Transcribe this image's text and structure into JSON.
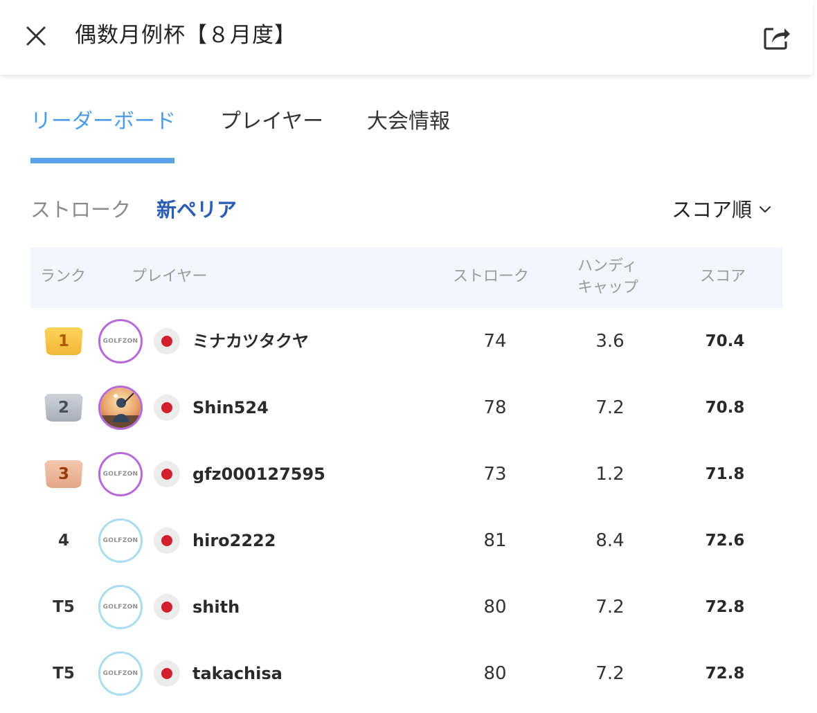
{
  "header": {
    "title": "偶数月例杯【８月度】"
  },
  "tabs": [
    {
      "label": "リーダーボード"
    },
    {
      "label": "プレイヤー"
    },
    {
      "label": "大会情報"
    }
  ],
  "subtabs": {
    "stroke": "ストローク",
    "new_peria": "新ペリア"
  },
  "sort": {
    "label": "スコア順"
  },
  "table": {
    "headers": {
      "rank": "ランク",
      "player": "プレイヤー",
      "stroke": "ストローク",
      "handicap_line1": "ハンディ",
      "handicap_line2": "キャップ",
      "score": "スコア"
    },
    "avatar_logo_text": "GOLFZON",
    "rows": [
      {
        "rank": "1",
        "name": "ミナカツタクヤ",
        "stroke": "74",
        "handicap": "3.6",
        "score": "70.4"
      },
      {
        "rank": "2",
        "name": "Shin524",
        "stroke": "78",
        "handicap": "7.2",
        "score": "70.8"
      },
      {
        "rank": "3",
        "name": "gfz000127595",
        "stroke": "73",
        "handicap": "1.2",
        "score": "71.8"
      },
      {
        "rank": "4",
        "name": "hiro2222",
        "stroke": "81",
        "handicap": "8.4",
        "score": "72.6"
      },
      {
        "rank": "T5",
        "name": "shith",
        "stroke": "80",
        "handicap": "7.2",
        "score": "72.8"
      },
      {
        "rank": "T5",
        "name": "takachisa",
        "stroke": "80",
        "handicap": "7.2",
        "score": "72.8"
      }
    ]
  },
  "colors": {
    "accent_tab": "#4a9ce8",
    "accent_subtab": "#2a5bb5",
    "flag_red": "#d21f2a"
  },
  "icons": {
    "close": "close-icon",
    "share": "share-icon",
    "chevron": "chevron-down-icon",
    "flag": "japan-flag-icon"
  }
}
